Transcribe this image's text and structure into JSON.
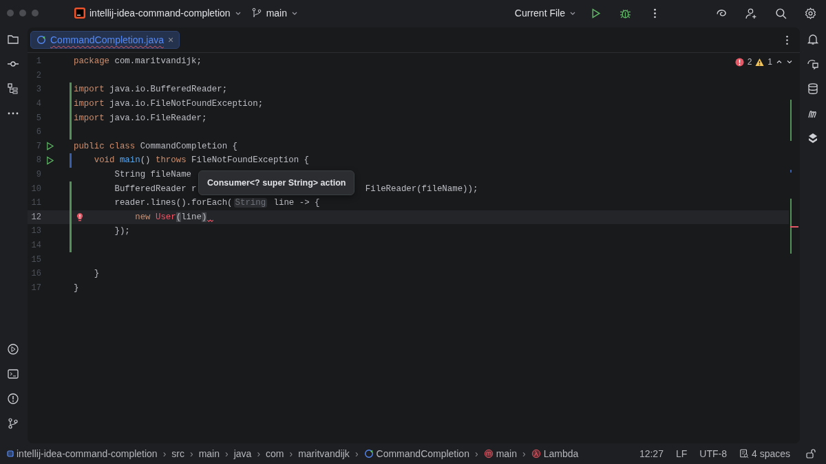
{
  "title_bar": {
    "project": "intellij-idea-command-completion",
    "branch": "main",
    "run_config": "Current File"
  },
  "editor": {
    "tabs": [
      {
        "label": "CommandCompletion.java",
        "close": "×",
        "selected": true
      }
    ],
    "problems": {
      "errors": "2",
      "warnings": "1"
    },
    "lines": [
      {
        "number": "1",
        "current": false,
        "run_marker": false,
        "intention_bulb": false,
        "added": false,
        "modified": false,
        "error_mark": false,
        "tokens": [
          {
            "kind": "keyword",
            "text": "package"
          },
          {
            "kind": "plain",
            "text": " com.maritvandijk;"
          }
        ]
      },
      {
        "number": "2",
        "current": false,
        "run_marker": false,
        "intention_bulb": false,
        "added": false,
        "modified": false,
        "error_mark": false
      },
      {
        "number": "3",
        "current": false,
        "run_marker": false,
        "intention_bulb": false,
        "added": true,
        "modified": false,
        "error_mark": false,
        "tokens": [
          {
            "kind": "keyword",
            "text": "import"
          },
          {
            "kind": "plain",
            "text": " java.io.BufferedReader;"
          }
        ]
      },
      {
        "number": "4",
        "current": false,
        "run_marker": false,
        "intention_bulb": false,
        "added": true,
        "modified": false,
        "error_mark": false,
        "tokens": [
          {
            "kind": "keyword",
            "text": "import"
          },
          {
            "kind": "plain",
            "text": " java.io.FileNotFoundException;"
          }
        ]
      },
      {
        "number": "5",
        "current": false,
        "run_marker": false,
        "intention_bulb": false,
        "added": true,
        "modified": false,
        "error_mark": false,
        "tokens": [
          {
            "kind": "keyword",
            "text": "import"
          },
          {
            "kind": "plain",
            "text": " java.io.FileReader;"
          }
        ]
      },
      {
        "number": "6",
        "current": false,
        "run_marker": false,
        "intention_bulb": false,
        "added": true,
        "modified": false,
        "error_mark": false
      },
      {
        "number": "7",
        "current": false,
        "run_marker": true,
        "intention_bulb": false,
        "added": false,
        "modified": false,
        "error_mark": false,
        "tokens": [
          {
            "kind": "keyword",
            "text": "public class"
          },
          {
            "kind": "plain",
            "text": " CommandCompletion {"
          }
        ]
      },
      {
        "number": "8",
        "current": false,
        "run_marker": true,
        "intention_bulb": false,
        "added": false,
        "modified": true,
        "error_mark": false,
        "tokens": [
          {
            "kind": "keyword",
            "text": "    void"
          },
          {
            "kind": "method",
            "text": " main"
          },
          {
            "kind": "plain",
            "text": "()"
          },
          {
            "kind": "keyword",
            "text": " throws"
          },
          {
            "kind": "plain",
            "text": " FileNotFoundException {"
          }
        ]
      },
      {
        "number": "9",
        "current": false,
        "run_marker": false,
        "intention_bulb": false,
        "added": false,
        "modified": false,
        "error_mark": false,
        "tokens": [
          {
            "kind": "plain",
            "text": "        String fileName"
          }
        ]
      },
      {
        "number": "10",
        "current": false,
        "run_marker": false,
        "intention_bulb": false,
        "added": true,
        "modified": false,
        "error_mark": false,
        "tokens": [
          {
            "kind": "plain",
            "text": "        BufferedReader r"
          },
          {
            "kind": "plain",
            "text": "FileReader(fileName));",
            "covered_before": true
          }
        ]
      },
      {
        "number": "11",
        "current": false,
        "run_marker": false,
        "intention_bulb": false,
        "added": true,
        "modified": false,
        "error_mark": false,
        "tokens": [
          {
            "kind": "plain",
            "text": "        reader.lines().forEach("
          },
          {
            "kind": "hint",
            "text": "String"
          },
          {
            "kind": "plain",
            "text": " line -> {"
          }
        ]
      },
      {
        "number": "12",
        "current": true,
        "run_marker": false,
        "intention_bulb": true,
        "added": true,
        "modified": false,
        "error_mark": true,
        "tokens": [
          {
            "kind": "keyword",
            "text": "            new"
          },
          {
            "kind": "error",
            "text": " User"
          },
          {
            "kind": "bracket",
            "text": "("
          },
          {
            "kind": "plain",
            "text": "line"
          },
          {
            "kind": "bracket",
            "text": ")"
          }
        ]
      },
      {
        "number": "13",
        "current": false,
        "run_marker": false,
        "intention_bulb": false,
        "added": true,
        "modified": false,
        "error_mark": false,
        "tokens": [
          {
            "kind": "plain",
            "text": "        });"
          }
        ]
      },
      {
        "number": "14",
        "current": false,
        "run_marker": false,
        "intention_bulb": false,
        "added": true,
        "modified": false,
        "error_mark": false
      },
      {
        "number": "15",
        "current": false,
        "run_marker": false,
        "intention_bulb": false,
        "added": false,
        "modified": false,
        "error_mark": false
      },
      {
        "number": "16",
        "current": false,
        "run_marker": false,
        "intention_bulb": false,
        "added": false,
        "modified": false,
        "error_mark": false,
        "tokens": [
          {
            "kind": "plain",
            "text": "    }"
          }
        ]
      },
      {
        "number": "17",
        "current": false,
        "run_marker": false,
        "intention_bulb": false,
        "added": false,
        "modified": false,
        "error_mark": false,
        "tokens": [
          {
            "kind": "plain",
            "text": "}"
          }
        ]
      }
    ],
    "tooltip": "Consumer<? super String> action"
  },
  "status_bar": {
    "breadcrumbs": [
      {
        "label": "intellij-idea-command-completion",
        "kind": "module"
      },
      {
        "separator": "›",
        "label": "src",
        "kind": "folder"
      },
      {
        "separator": "›",
        "label": "main",
        "kind": "folder"
      },
      {
        "separator": "›",
        "label": "java",
        "kind": "folder"
      },
      {
        "separator": "›",
        "label": "com",
        "kind": "folder"
      },
      {
        "separator": "›",
        "label": "maritvandijk",
        "kind": "folder"
      },
      {
        "separator": "›",
        "label": "CommandCompletion",
        "kind": "class"
      },
      {
        "separator": "›",
        "label": "main",
        "kind": "method"
      },
      {
        "separator": "›",
        "label": "Lambda",
        "kind": "lambda"
      }
    ],
    "position": "12:27",
    "line_ending": "LF",
    "encoding": "UTF-8",
    "indent": "4 spaces"
  }
}
